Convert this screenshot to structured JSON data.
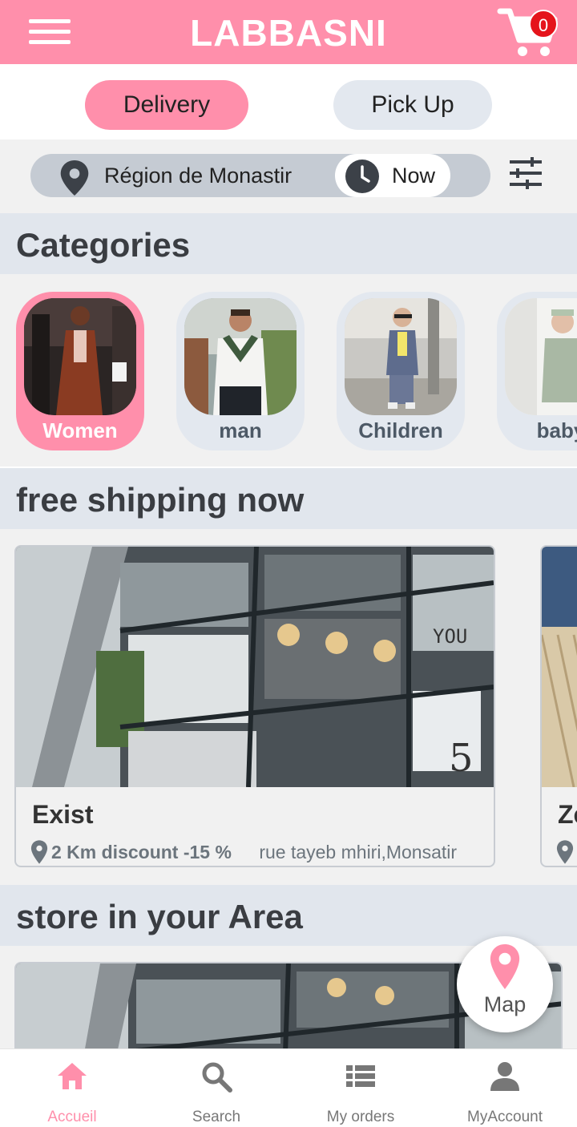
{
  "header": {
    "title": "LABBASNI",
    "cart_count": "0",
    "brand_color": "#ff8fab"
  },
  "mode": {
    "delivery_label": "Delivery",
    "pickup_label": "Pick Up",
    "selected": "Delivery"
  },
  "location": {
    "region": "Région de Monastir",
    "time": "Now"
  },
  "categories": {
    "title": "Categories",
    "items": [
      {
        "label": "Women",
        "active": true
      },
      {
        "label": "man",
        "active": false
      },
      {
        "label": "Children",
        "active": false
      },
      {
        "label": "baby",
        "active": false
      }
    ]
  },
  "free_shipping": {
    "title": "free shipping now",
    "stores": [
      {
        "name": "Exist",
        "distance": "2 Km discount -15 %",
        "address": "rue tayeb mhiri,Monsatir"
      },
      {
        "name": "Ze"
      }
    ]
  },
  "area": {
    "title": "store in your Area"
  },
  "map_button": {
    "label": "Map"
  },
  "bottom_nav": {
    "items": [
      {
        "label": "Accueil",
        "icon": "home-icon",
        "active": true
      },
      {
        "label": "Search",
        "icon": "search-icon",
        "active": false
      },
      {
        "label": "My orders",
        "icon": "list-icon",
        "active": false
      },
      {
        "label": "MyAccount",
        "icon": "person-icon",
        "active": false
      }
    ]
  }
}
